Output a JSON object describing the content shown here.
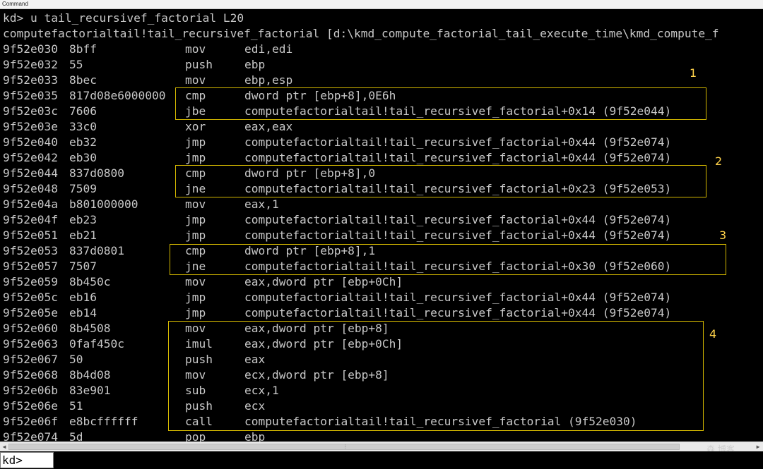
{
  "window": {
    "title": "Command"
  },
  "lines": [
    {
      "kind": "text",
      "text": "kd> u tail_recursivef_factorial L20"
    },
    {
      "kind": "text",
      "text": "computefactorialtail!tail_recursivef_factorial [d:\\kmd_compute_factorial_tail_execute_time\\kmd_compute_f"
    },
    {
      "kind": "asm",
      "addr": "9f52e030",
      "bytes": "8bff",
      "mnem": "mov",
      "ops": "edi,edi"
    },
    {
      "kind": "asm",
      "addr": "9f52e032",
      "bytes": "55",
      "mnem": "push",
      "ops": "ebp"
    },
    {
      "kind": "asm",
      "addr": "9f52e033",
      "bytes": "8bec",
      "mnem": "mov",
      "ops": "ebp,esp"
    },
    {
      "kind": "asm",
      "addr": "9f52e035",
      "bytes": "817d08e6000000",
      "mnem": "cmp",
      "ops": "dword ptr [ebp+8],0E6h"
    },
    {
      "kind": "asm",
      "addr": "9f52e03c",
      "bytes": "7606",
      "mnem": "jbe",
      "ops": "computefactorialtail!tail_recursivef_factorial+0x14 (9f52e044)"
    },
    {
      "kind": "asm",
      "addr": "9f52e03e",
      "bytes": "33c0",
      "mnem": "xor",
      "ops": "eax,eax"
    },
    {
      "kind": "asm",
      "addr": "9f52e040",
      "bytes": "eb32",
      "mnem": "jmp",
      "ops": "computefactorialtail!tail_recursivef_factorial+0x44 (9f52e074)"
    },
    {
      "kind": "asm",
      "addr": "9f52e042",
      "bytes": "eb30",
      "mnem": "jmp",
      "ops": "computefactorialtail!tail_recursivef_factorial+0x44 (9f52e074)"
    },
    {
      "kind": "asm",
      "addr": "9f52e044",
      "bytes": "837d0800",
      "mnem": "cmp",
      "ops": "dword ptr [ebp+8],0"
    },
    {
      "kind": "asm",
      "addr": "9f52e048",
      "bytes": "7509",
      "mnem": "jne",
      "ops": "computefactorialtail!tail_recursivef_factorial+0x23 (9f52e053)"
    },
    {
      "kind": "asm",
      "addr": "9f52e04a",
      "bytes": "b801000000",
      "mnem": "mov",
      "ops": "eax,1"
    },
    {
      "kind": "asm",
      "addr": "9f52e04f",
      "bytes": "eb23",
      "mnem": "jmp",
      "ops": "computefactorialtail!tail_recursivef_factorial+0x44 (9f52e074)"
    },
    {
      "kind": "asm",
      "addr": "9f52e051",
      "bytes": "eb21",
      "mnem": "jmp",
      "ops": "computefactorialtail!tail_recursivef_factorial+0x44 (9f52e074)"
    },
    {
      "kind": "asm",
      "addr": "9f52e053",
      "bytes": "837d0801",
      "mnem": "cmp",
      "ops": "dword ptr [ebp+8],1"
    },
    {
      "kind": "asm",
      "addr": "9f52e057",
      "bytes": "7507",
      "mnem": "jne",
      "ops": "computefactorialtail!tail_recursivef_factorial+0x30 (9f52e060)"
    },
    {
      "kind": "asm",
      "addr": "9f52e059",
      "bytes": "8b450c",
      "mnem": "mov",
      "ops": "eax,dword ptr [ebp+0Ch]"
    },
    {
      "kind": "asm",
      "addr": "9f52e05c",
      "bytes": "eb16",
      "mnem": "jmp",
      "ops": "computefactorialtail!tail_recursivef_factorial+0x44 (9f52e074)"
    },
    {
      "kind": "asm",
      "addr": "9f52e05e",
      "bytes": "eb14",
      "mnem": "jmp",
      "ops": "computefactorialtail!tail_recursivef_factorial+0x44 (9f52e074)"
    },
    {
      "kind": "asm",
      "addr": "9f52e060",
      "bytes": "8b4508",
      "mnem": "mov",
      "ops": "eax,dword ptr [ebp+8]"
    },
    {
      "kind": "asm",
      "addr": "9f52e063",
      "bytes": "0faf450c",
      "mnem": "imul",
      "ops": "eax,dword ptr [ebp+0Ch]"
    },
    {
      "kind": "asm",
      "addr": "9f52e067",
      "bytes": "50",
      "mnem": "push",
      "ops": "eax"
    },
    {
      "kind": "asm",
      "addr": "9f52e068",
      "bytes": "8b4d08",
      "mnem": "mov",
      "ops": "ecx,dword ptr [ebp+8]"
    },
    {
      "kind": "asm",
      "addr": "9f52e06b",
      "bytes": "83e901",
      "mnem": "sub",
      "ops": "ecx,1"
    },
    {
      "kind": "asm",
      "addr": "9f52e06e",
      "bytes": "51",
      "mnem": "push",
      "ops": "ecx"
    },
    {
      "kind": "asm",
      "addr": "9f52e06f",
      "bytes": "e8bcffffff",
      "mnem": "call",
      "ops": "computefactorialtail!tail_recursivef_factorial (9f52e030)"
    },
    {
      "kind": "asm",
      "addr": "9f52e074",
      "bytes": "5d",
      "mnem": "pop",
      "ops": "ebp"
    }
  ],
  "annotations": [
    "1",
    "2",
    "3",
    "4"
  ],
  "annotation_color": "#d4b800",
  "scrollbar": {
    "grip": "⦙"
  },
  "watermark": "森 博客",
  "command": {
    "prompt": "kd>"
  }
}
